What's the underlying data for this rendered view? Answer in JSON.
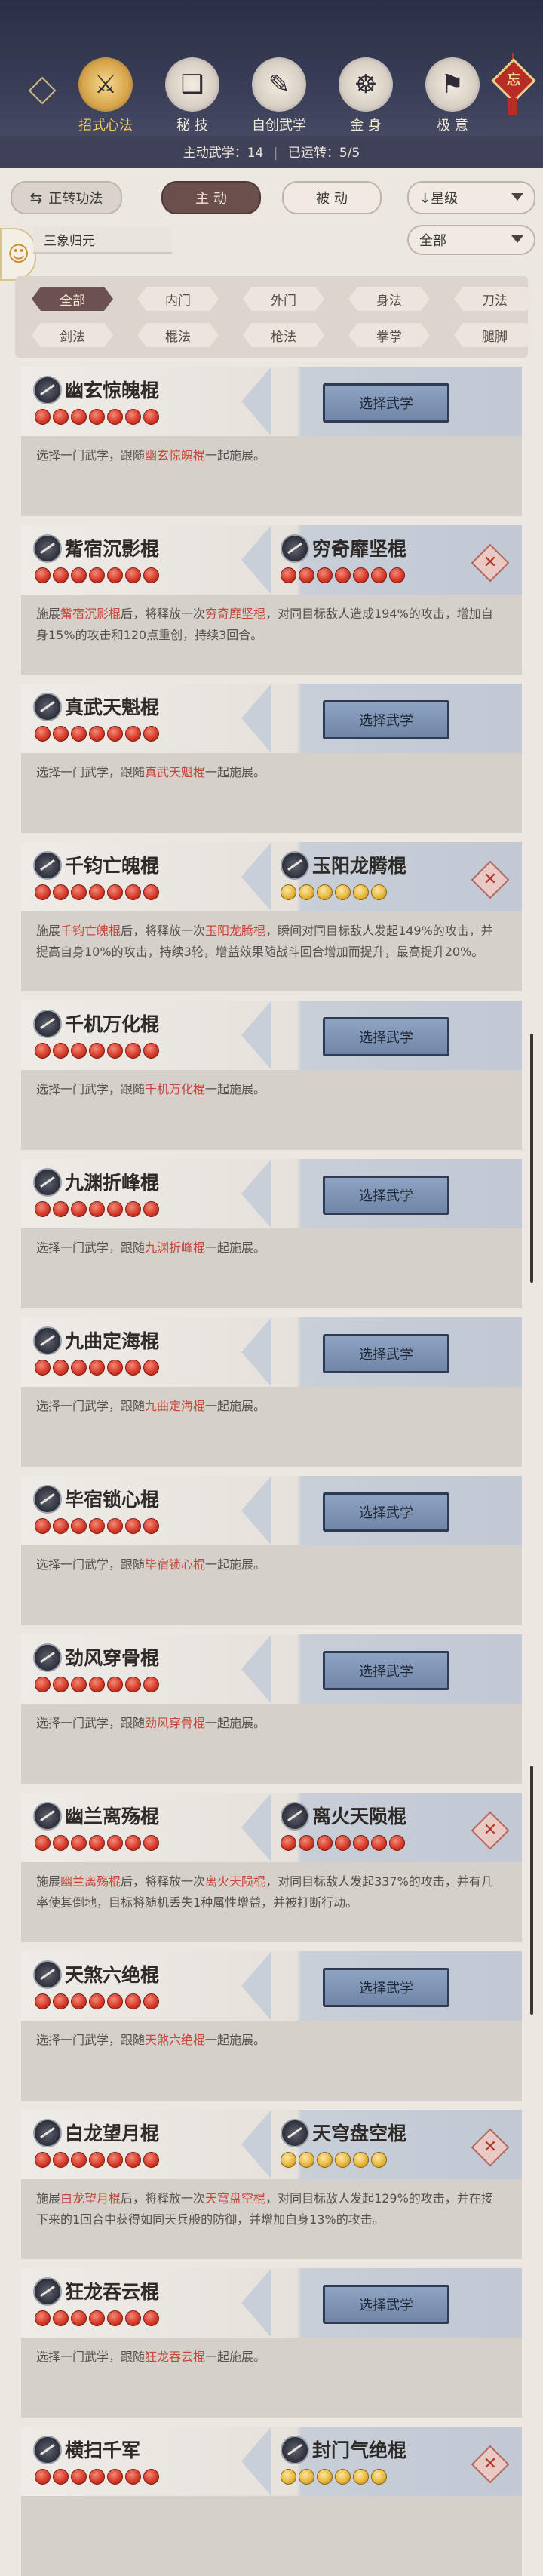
{
  "header": {
    "tabs": [
      {
        "label": "招式心法",
        "glyph": "⚔",
        "icon": "sword-icon",
        "active": true
      },
      {
        "label": "秘 技",
        "glyph": "❑",
        "icon": "book-icon",
        "active": false
      },
      {
        "label": "自创武学",
        "glyph": "✎",
        "icon": "scroll-icon",
        "active": false
      },
      {
        "label": "金 身",
        "glyph": "☸",
        "icon": "meditation-icon",
        "active": false
      },
      {
        "label": "极 意",
        "glyph": "⚑",
        "icon": "spear-icon",
        "active": false
      }
    ],
    "seal_text": "忘",
    "stats": {
      "active_martial": "主动武学：14",
      "running": "已运转：5/5"
    }
  },
  "controls": {
    "transfer_label": "正转功法",
    "transfer_icon": "⇆",
    "active_tab": "主 动",
    "passive_tab": "被 动",
    "sort_label": "↓星级",
    "preset_label": "三象归元",
    "filter_label": "全部"
  },
  "categories": [
    "全部",
    "内门",
    "外门",
    "身法",
    "刀法",
    "剑法",
    "棍法",
    "枪法",
    "拳掌",
    "腿脚"
  ],
  "select_label": "选择武学",
  "cards": [
    {
      "name": "幽玄惊魄棍",
      "stars": 7,
      "paired": false,
      "desc": [
        "选择一门武学，跟随",
        "幽玄惊魄棍",
        "一起施展。"
      ]
    },
    {
      "name": "觜宿沉影棍",
      "stars": 7,
      "paired": true,
      "partner": "穷奇靡坚棍",
      "partner_stars": 7,
      "partner_gold": false,
      "desc": [
        "施展",
        "觜宿沉影棍",
        "后，将释放一次",
        "穷奇靡坚棍",
        "，对同目标敌人造成194%的攻击，增加自身15%的攻击和120点重创，持续3回合。"
      ]
    },
    {
      "name": "真武天魁棍",
      "stars": 7,
      "paired": false,
      "desc": [
        "选择一门武学，跟随",
        "真武天魁棍",
        "一起施展。"
      ]
    },
    {
      "name": "千钧亡魄棍",
      "stars": 7,
      "paired": true,
      "partner": "玉阳龙腾棍",
      "partner_stars": 6,
      "partner_gold": true,
      "desc": [
        "施展",
        "千钧亡魄棍",
        "后，将释放一次",
        "玉阳龙腾棍",
        "，瞬间对同目标敌人发起149%的攻击，并提高自身10%的攻击，持续3轮，增益效果随战斗回合增加而提升，最高提升20%。"
      ]
    },
    {
      "name": "千机万化棍",
      "stars": 7,
      "paired": false,
      "desc": [
        "选择一门武学，跟随",
        "千机万化棍",
        "一起施展。"
      ]
    },
    {
      "name": "九渊折峰棍",
      "stars": 7,
      "paired": false,
      "desc": [
        "选择一门武学，跟随",
        "九渊折峰棍",
        "一起施展。"
      ]
    },
    {
      "name": "九曲定海棍",
      "stars": 7,
      "paired": false,
      "desc": [
        "选择一门武学，跟随",
        "九曲定海棍",
        "一起施展。"
      ]
    },
    {
      "name": "毕宿锁心棍",
      "stars": 7,
      "paired": false,
      "desc": [
        "选择一门武学，跟随",
        "毕宿锁心棍",
        "一起施展。"
      ]
    },
    {
      "name": "劲风穿骨棍",
      "stars": 7,
      "paired": false,
      "desc": [
        "选择一门武学，跟随",
        "劲风穿骨棍",
        "一起施展。"
      ]
    },
    {
      "name": "幽兰离殇棍",
      "stars": 7,
      "paired": true,
      "partner": "离火天陨棍",
      "partner_stars": 7,
      "partner_gold": false,
      "desc": [
        "施展",
        "幽兰离殇棍",
        "后，将释放一次",
        "离火天陨棍",
        "，对同目标敌人发起337%的攻击，并有几率使其倒地，目标将随机丢失1种属性增益，并被打断行动。"
      ]
    },
    {
      "name": "天煞六绝棍",
      "stars": 7,
      "paired": false,
      "desc": [
        "选择一门武学，跟随",
        "天煞六绝棍",
        "一起施展。"
      ]
    },
    {
      "name": "白龙望月棍",
      "stars": 7,
      "paired": true,
      "partner": "天穹盘空棍",
      "partner_stars": 6,
      "partner_gold": true,
      "desc": [
        "施展",
        "白龙望月棍",
        "后，将释放一次",
        "天穹盘空棍",
        "，对同目标敌人发起129%的攻击，并在接下来的1回合中获得如同天兵般的防御，并增加自身13%的攻击。"
      ]
    },
    {
      "name": "狂龙吞云棍",
      "stars": 7,
      "paired": false,
      "desc": [
        "选择一门武学，跟随",
        "狂龙吞云棍",
        "一起施展。"
      ]
    },
    {
      "name": "横扫千军",
      "stars": 7,
      "paired": true,
      "partner": "封门气绝棍",
      "partner_stars": 6,
      "partner_gold": true,
      "desc": [
        "",
        "",
        "",
        "",
        ""
      ]
    }
  ]
}
